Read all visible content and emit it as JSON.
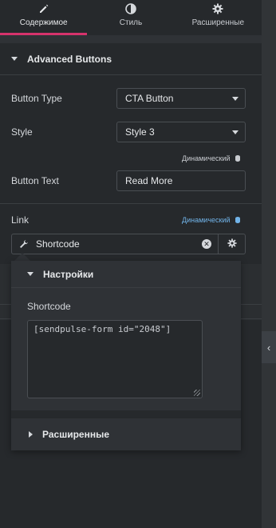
{
  "tabs": [
    {
      "label": "Содержимое",
      "icon": "pencil-icon",
      "active": true
    },
    {
      "label": "Стиль",
      "icon": "half-circle-icon",
      "active": false
    },
    {
      "label": "Расширенные",
      "icon": "gear-icon",
      "active": false
    }
  ],
  "section": {
    "title": "Advanced Buttons"
  },
  "fields": {
    "button_type": {
      "label": "Button Type",
      "value": "CTA Button"
    },
    "style": {
      "label": "Style",
      "value": "Style 3"
    },
    "dynamic_label": "Динамический",
    "button_text": {
      "label": "Button Text",
      "value": "Read More"
    },
    "link": {
      "label": "Link",
      "dynamic_label": "Динамический",
      "value": "Shortcode"
    }
  },
  "popover": {
    "title": "Настройки",
    "shortcode_label": "Shortcode",
    "shortcode_value": "[sendpulse-form id=\"2048\"]",
    "advanced_label": "Расширенные"
  },
  "colors": {
    "accent": "#d6336c",
    "dynamic_blue": "#71b3e8",
    "bg": "#26292c"
  }
}
